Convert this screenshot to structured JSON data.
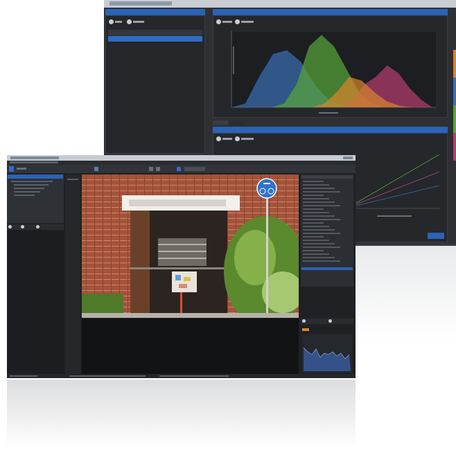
{
  "back_window": {
    "left_panel": {
      "list_items": [
        "",
        ""
      ]
    },
    "spectrum_panel": {
      "series_colors": [
        "#3a6fb5",
        "#59a638",
        "#b83c70",
        "#d9862c"
      ]
    },
    "bottom_panel": {
      "line_colors": [
        "#5aa23a",
        "#b5488a",
        "#3a6fb5"
      ]
    }
  },
  "front_window": {
    "histogram_color": "#4a78c4"
  },
  "chart_data": {
    "type": "area",
    "series": [
      {
        "values": [
          0,
          5,
          40,
          70,
          75,
          60,
          30,
          10,
          3,
          0
        ]
      },
      {
        "values": [
          0,
          0,
          5,
          30,
          80,
          95,
          80,
          50,
          20,
          5,
          0
        ]
      },
      {
        "values": [
          0,
          0,
          0,
          0,
          10,
          30,
          40,
          55,
          45,
          25,
          10,
          0
        ]
      },
      {
        "values": [
          0,
          0,
          0,
          5,
          20,
          40,
          35,
          20,
          8,
          2,
          0
        ]
      }
    ]
  }
}
